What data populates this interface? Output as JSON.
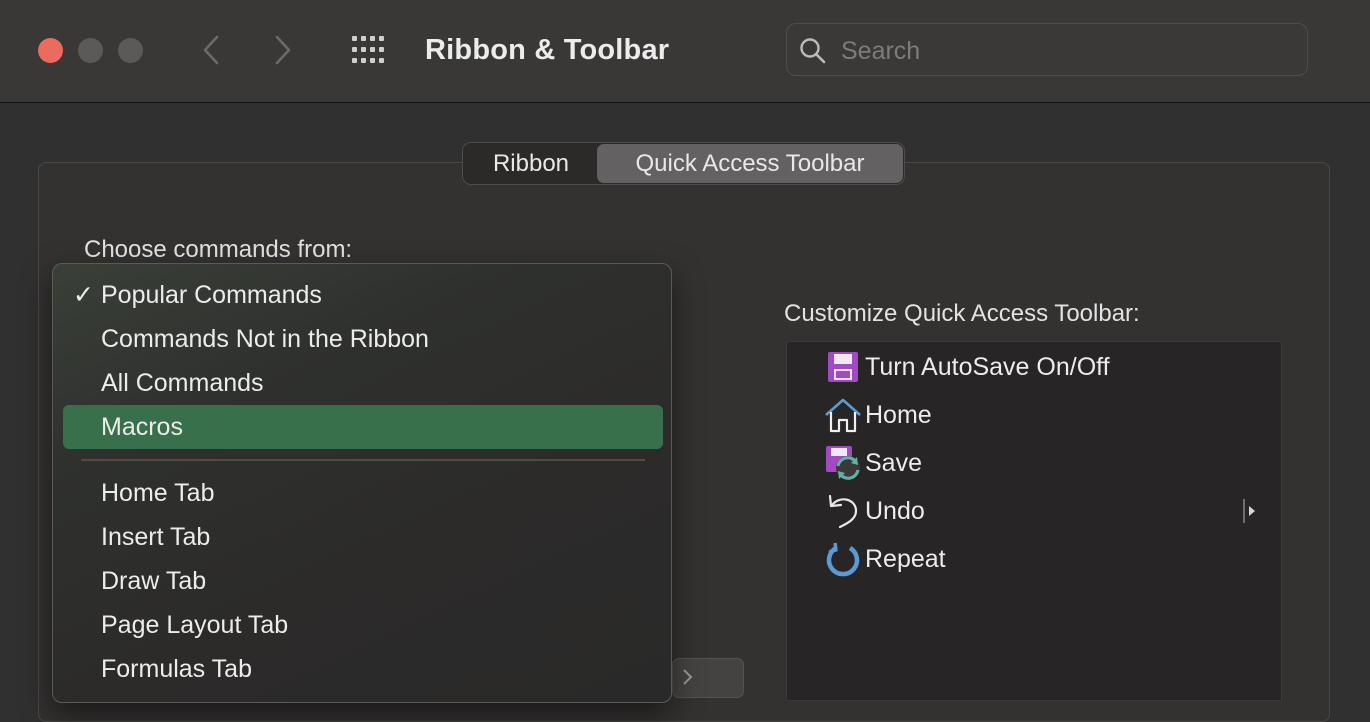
{
  "window": {
    "title": "Ribbon & Toolbar",
    "traffic_lights": {
      "close_color": "#ec6a5e",
      "inactive_color": "#5c5a59"
    },
    "search": {
      "placeholder": "Search",
      "value": ""
    }
  },
  "tabs": [
    {
      "label": "Ribbon",
      "active": false
    },
    {
      "label": "Quick Access Toolbar",
      "active": true
    }
  ],
  "choose_commands": {
    "label": "Choose commands from:",
    "options": [
      {
        "label": "Popular Commands",
        "checked": true
      },
      {
        "label": "Commands Not in the Ribbon"
      },
      {
        "label": "All Commands"
      },
      {
        "label": "Macros",
        "highlighted": true
      },
      {
        "label": "Home Tab"
      },
      {
        "label": "Insert Tab"
      },
      {
        "label": "Draw Tab"
      },
      {
        "label": "Page Layout Tab"
      },
      {
        "label": "Formulas Tab"
      }
    ],
    "check_glyph": "✓",
    "highlight_color": "#37704a"
  },
  "customize": {
    "label": "Customize Quick Access Toolbar:",
    "items": [
      {
        "label": "Turn AutoSave On/Off",
        "icon": "autosave-icon"
      },
      {
        "label": "Home",
        "icon": "home-icon"
      },
      {
        "label": "Save",
        "icon": "save-sync-icon"
      },
      {
        "label": "Undo",
        "icon": "undo-icon",
        "has_submenu": true
      },
      {
        "label": "Repeat",
        "icon": "repeat-icon"
      }
    ]
  }
}
